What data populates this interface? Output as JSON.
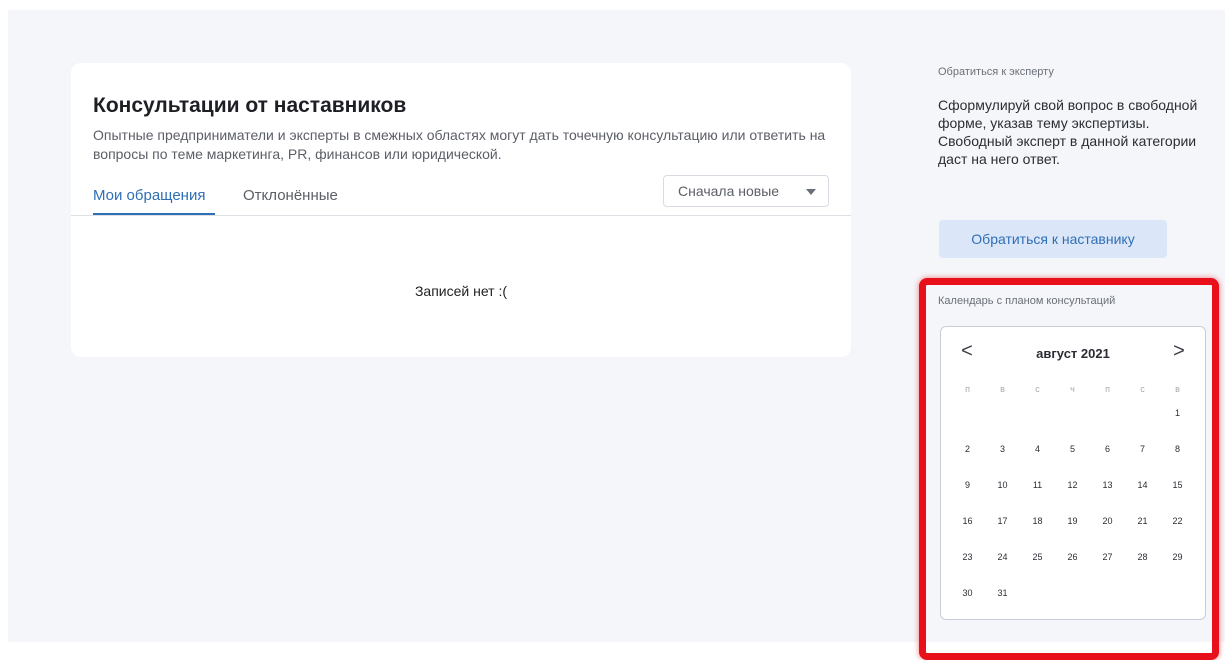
{
  "main": {
    "title": "Консультации от наставников",
    "description": "Опытные предприниматели и эксперты в смежных областях могут дать точечную консультацию или ответить на вопросы по теме маркетинга, PR, финансов или юридической.",
    "tabs": [
      {
        "label": "Мои обращения",
        "active": true
      },
      {
        "label": "Отклонённые",
        "active": false
      }
    ],
    "sort": {
      "selected": "Сначала новые"
    },
    "empty_message": "Записей нет :("
  },
  "sidebar": {
    "caption": "Обратиться к эксперту",
    "text": "Сформулируй свой вопрос в свободной форме, указав тему экспертизы. Свободный эксперт в данной категории даст на него ответ.",
    "button_label": "Обратиться к наставнику",
    "calendar_caption": "Календарь с планом консультаций"
  },
  "calendar": {
    "month_label": "август 2021",
    "prev_icon": "chevron-left-icon",
    "next_icon": "chevron-right-icon",
    "prev_glyph": "<",
    "next_glyph": ">",
    "weekdays": [
      "п",
      "в",
      "с",
      "ч",
      "п",
      "с",
      "в"
    ],
    "weeks": [
      [
        "",
        "",
        "",
        "",
        "",
        "",
        "1"
      ],
      [
        "2",
        "3",
        "4",
        "5",
        "6",
        "7",
        "8"
      ],
      [
        "9",
        "10",
        "11",
        "12",
        "13",
        "14",
        "15"
      ],
      [
        "16",
        "17",
        "18",
        "19",
        "20",
        "21",
        "22"
      ],
      [
        "23",
        "24",
        "25",
        "26",
        "27",
        "28",
        "29"
      ],
      [
        "30",
        "31",
        "",
        "",
        "",
        "",
        ""
      ]
    ]
  },
  "colors": {
    "accent": "#2f6fb6",
    "button_bg": "#dbe6f8",
    "page_bg": "#f4f6f9",
    "highlight": "#e8101a"
  }
}
